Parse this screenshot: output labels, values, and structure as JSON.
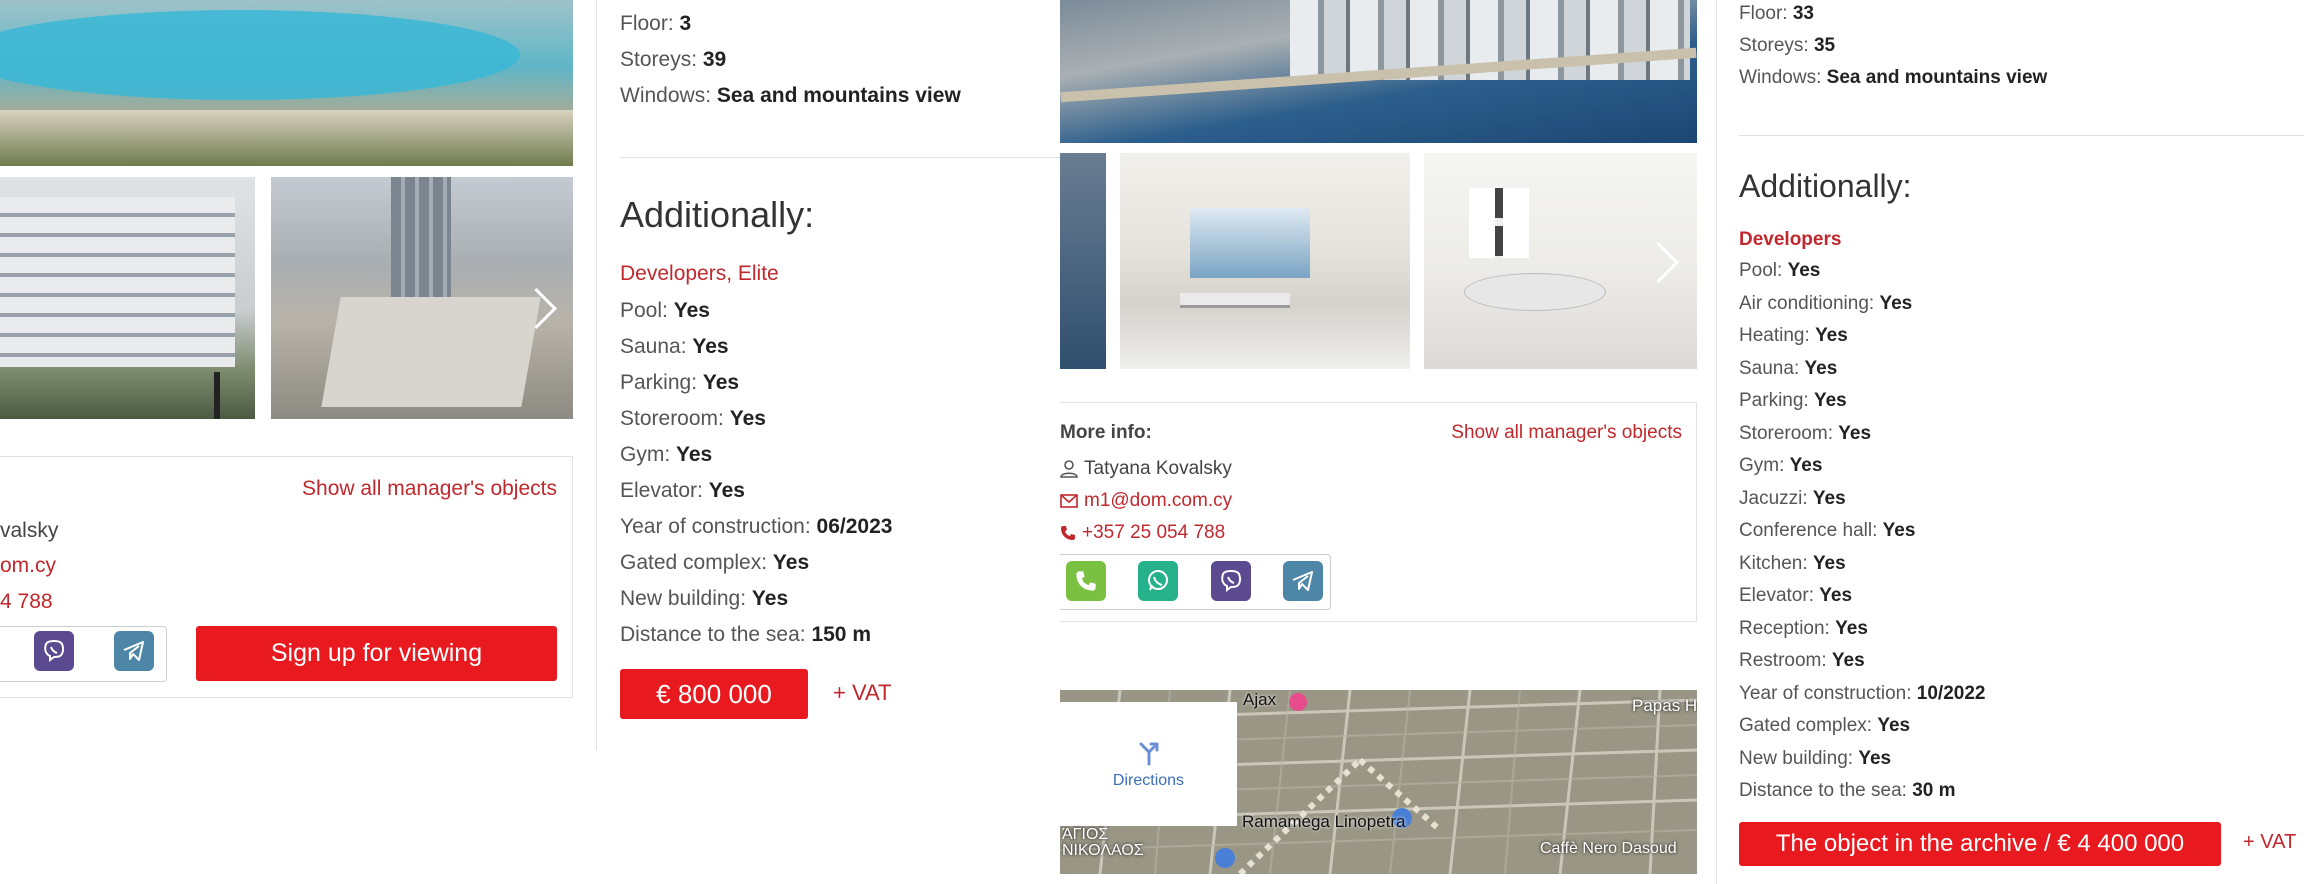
{
  "left_listing": {
    "manager": {
      "show_all_label": "Show all manager's objects",
      "name_partial": "valsky",
      "email_partial": "om.cy",
      "phone_partial": "4 788"
    },
    "signup_label": "Sign up for viewing"
  },
  "middle_listing": {
    "specs": [
      {
        "label": "Floor:",
        "value": "3"
      },
      {
        "label": "Storeys:",
        "value": "39"
      },
      {
        "label": "Windows:",
        "value": "Sea and mountains view"
      }
    ],
    "additionally_heading": "Additionally:",
    "category": "Developers, Elite",
    "features": [
      {
        "label": "Pool:",
        "value": "Yes"
      },
      {
        "label": "Sauna:",
        "value": "Yes"
      },
      {
        "label": "Parking:",
        "value": "Yes"
      },
      {
        "label": "Storeroom:",
        "value": "Yes"
      },
      {
        "label": "Gym:",
        "value": "Yes"
      },
      {
        "label": "Elevator:",
        "value": "Yes"
      },
      {
        "label": "Year of construction:",
        "value": "06/2023"
      },
      {
        "label": "Gated complex:",
        "value": "Yes"
      },
      {
        "label": "New building:",
        "value": "Yes"
      },
      {
        "label": "Distance to the sea:",
        "value": "150 m"
      }
    ],
    "price": "€ 800 000",
    "vat": "+ VAT"
  },
  "right_listing": {
    "more_info_label": "More info:",
    "show_all_label": "Show all manager's objects",
    "manager_name": "Tatyana Kovalsky",
    "manager_email": "m1@dom.com.cy",
    "manager_phone": "+357 25 054 788",
    "map": {
      "directions_label": "Directions",
      "labels": [
        "Ajax",
        "Papas H",
        "Ramamega Linopetra",
        "ΆΓΙΟΣ",
        "ΝΙΚΟΛΑΟΣ",
        "Caffè Nero Dasoud"
      ]
    },
    "specs": [
      {
        "label": "Floor:",
        "value": "33"
      },
      {
        "label": "Storeys:",
        "value": "35"
      },
      {
        "label": "Windows:",
        "value": "Sea and mountains view"
      }
    ],
    "additionally_heading": "Additionally:",
    "category": "Developers",
    "features": [
      {
        "label": "Pool:",
        "value": "Yes"
      },
      {
        "label": "Air conditioning:",
        "value": "Yes"
      },
      {
        "label": "Heating:",
        "value": "Yes"
      },
      {
        "label": "Sauna:",
        "value": "Yes"
      },
      {
        "label": "Parking:",
        "value": "Yes"
      },
      {
        "label": "Storeroom:",
        "value": "Yes"
      },
      {
        "label": "Gym:",
        "value": "Yes"
      },
      {
        "label": "Jacuzzi:",
        "value": "Yes"
      },
      {
        "label": "Conference hall:",
        "value": "Yes"
      },
      {
        "label": "Kitchen:",
        "value": "Yes"
      },
      {
        "label": "Elevator:",
        "value": "Yes"
      },
      {
        "label": "Reception:",
        "value": "Yes"
      },
      {
        "label": "Restroom:",
        "value": "Yes"
      },
      {
        "label": "Year of construction:",
        "value": "10/2022"
      },
      {
        "label": "Gated complex:",
        "value": "Yes"
      },
      {
        "label": "New building:",
        "value": "Yes"
      },
      {
        "label": "Distance to the sea:",
        "value": "30 m"
      }
    ],
    "archive_label": "The object in the archive / € 4 400 000",
    "vat": "+ VAT"
  },
  "colors": {
    "accent_red": "#e8191f",
    "link_red": "#c0282d",
    "call_green": "#7ac142",
    "whatsapp_green": "#25b28a",
    "viber_purple": "#5b4a8f",
    "telegram_blue": "#4e86a8"
  }
}
